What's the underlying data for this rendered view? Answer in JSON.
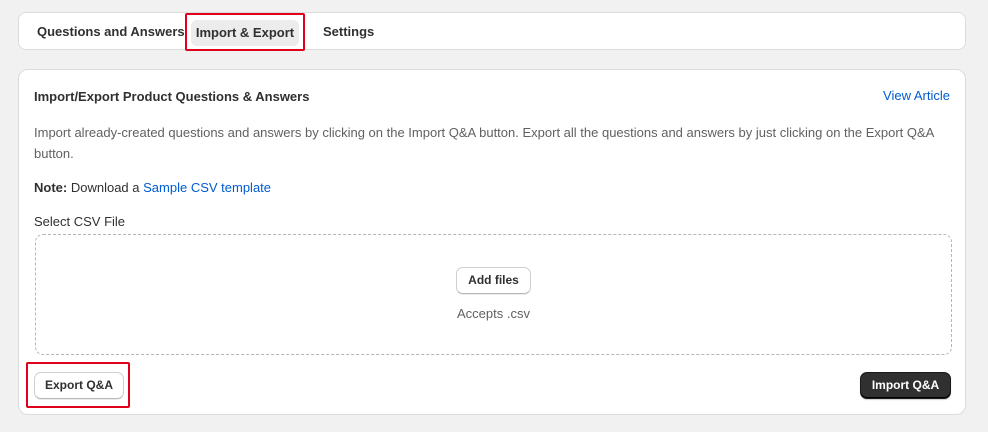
{
  "tabs": [
    {
      "label": "Questions and Answers",
      "selected": false
    },
    {
      "label": "Import & Export",
      "selected": true
    },
    {
      "label": "Settings",
      "selected": false
    }
  ],
  "card": {
    "title": "Import/Export Product Questions & Answers",
    "view_article": "View Article",
    "description": "Import already-created questions and answers by clicking on the Import Q&A button. Export all the questions and answers by just clicking on the Export Q&A button.",
    "note_label": "Note:",
    "note_text": "Download a",
    "note_link": "Sample CSV template",
    "file_label": "Select CSV File",
    "dropzone": {
      "button": "Add files",
      "accepts": "Accepts .csv"
    },
    "export_button": "Export Q&A",
    "import_button": "Import Q&A"
  },
  "colors": {
    "link": "#005bd3",
    "highlight": "#e0001b",
    "primary_button": "#303030"
  }
}
